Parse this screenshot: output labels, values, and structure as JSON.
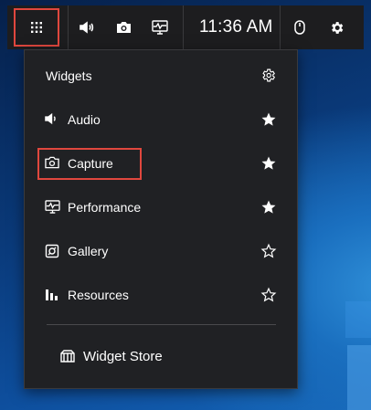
{
  "topbar": {
    "time": "11:36 AM",
    "icons": [
      "menu-grid-icon",
      "volume-icon",
      "camera-icon",
      "performance-icon",
      "mouse-icon",
      "gear-icon"
    ]
  },
  "panel": {
    "header": {
      "label": "Widgets",
      "icon": "gear-icon"
    },
    "items": [
      {
        "label": "Audio",
        "icon": "volume-icon",
        "favorite": true
      },
      {
        "label": "Capture",
        "icon": "camera-icon",
        "favorite": true,
        "highlighted": true
      },
      {
        "label": "Performance",
        "icon": "performance-icon",
        "favorite": true
      },
      {
        "label": "Gallery",
        "icon": "gallery-icon",
        "favorite": false
      },
      {
        "label": "Resources",
        "icon": "resources-icon",
        "favorite": false
      }
    ],
    "store": {
      "label": "Widget Store",
      "icon": "store-icon"
    }
  },
  "colors": {
    "highlight": "#e0473e",
    "panel_bg": "#202124",
    "topbar_bg": "#1d1d1f"
  }
}
